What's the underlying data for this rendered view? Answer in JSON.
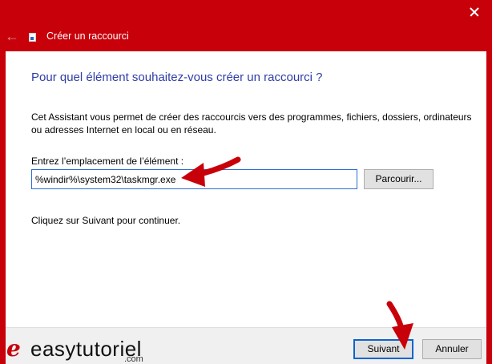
{
  "window": {
    "title": "Créer un raccourci",
    "back_glyph": "←",
    "close_icon": "close-icon"
  },
  "wizard": {
    "heading": "Pour quel élément souhaitez-vous créer un raccourci ?",
    "description": "Cet Assistant vous permet de créer des raccourcis vers des programmes, fichiers, dossiers, ordinateurs ou adresses Internet en local ou en réseau.",
    "location_label": "Entrez l’emplacement de l’élément :",
    "location_value": "%windir%\\system32\\taskmgr.exe",
    "browse_label": "Parcourir...",
    "continue_text": "Cliquez sur Suivant pour continuer."
  },
  "footer": {
    "next_label": "Suivant",
    "cancel_label": "Annuler"
  },
  "watermark": {
    "mark": "e",
    "name": "easytutoriel",
    "suffix": ".com"
  },
  "colors": {
    "titlebar": "#c8000a",
    "heading": "#2e3ea6",
    "annotation_arrow": "#c8000a",
    "focus_border": "#0a64d0"
  }
}
